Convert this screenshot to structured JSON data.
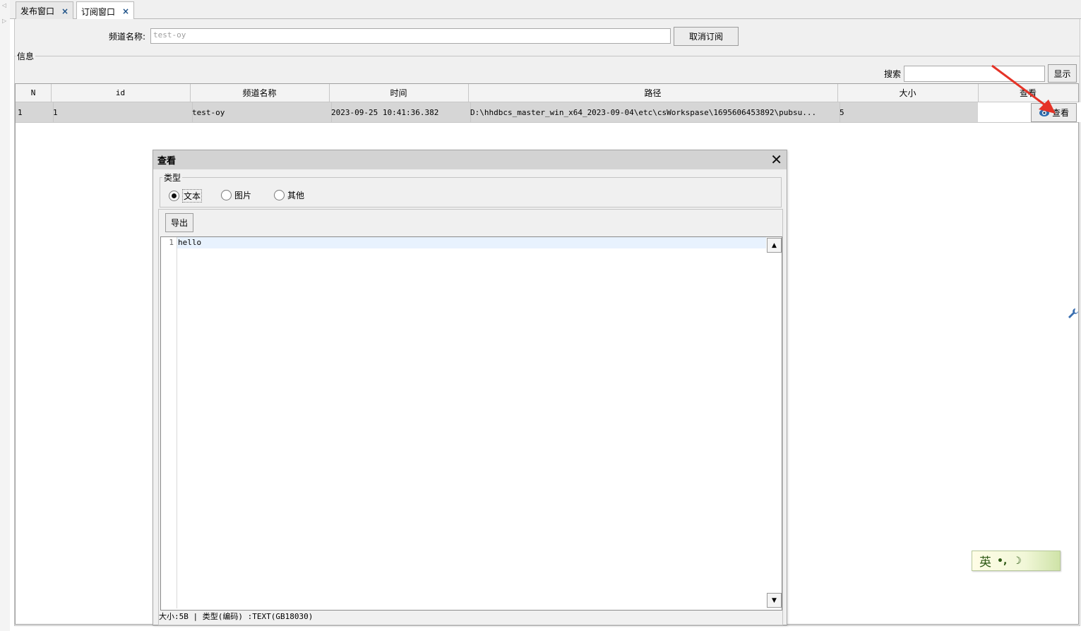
{
  "tabs": [
    {
      "label": "发布窗口",
      "close": "×"
    },
    {
      "label": "订阅窗口",
      "close": "×"
    }
  ],
  "channel": {
    "label": "频道名称:",
    "value": "test-oy",
    "unsubscribe_button": "取消订阅"
  },
  "info_group": {
    "title": "信息",
    "search_label": "搜索",
    "search_value": "",
    "show_button": "显示"
  },
  "table": {
    "columns": [
      "N",
      "id",
      "频道名称",
      "时间",
      "路径",
      "大小",
      "查看"
    ],
    "rows": [
      {
        "n": "1",
        "id": "1",
        "channel": "test-oy",
        "time": "2023-09-25 10:41:36.382",
        "path": "D:\\hhdbcs_master_win_x64_2023-09-04\\etc\\csWorkspase\\1695606453892\\pubsu...",
        "size": "5",
        "view_button": "查看"
      }
    ]
  },
  "dialog": {
    "title": "查看",
    "close": "✕",
    "type_group_title": "类型",
    "radios": [
      {
        "label": "文本",
        "selected": true
      },
      {
        "label": "图片",
        "selected": false
      },
      {
        "label": "其他",
        "selected": false
      }
    ],
    "export_button": "导出",
    "editor": {
      "line_number": "1",
      "content": "hello"
    },
    "status": "大小:5B | 类型(编码) :TEXT(GB18030)"
  },
  "ime": {
    "label": "英",
    "extra": "•,"
  },
  "colors": {
    "title_bar": "#d3d3d3",
    "row_selected": "#d6d6d6",
    "annotation_arrow": "#e53327",
    "tab_close": "#1b4f86"
  }
}
